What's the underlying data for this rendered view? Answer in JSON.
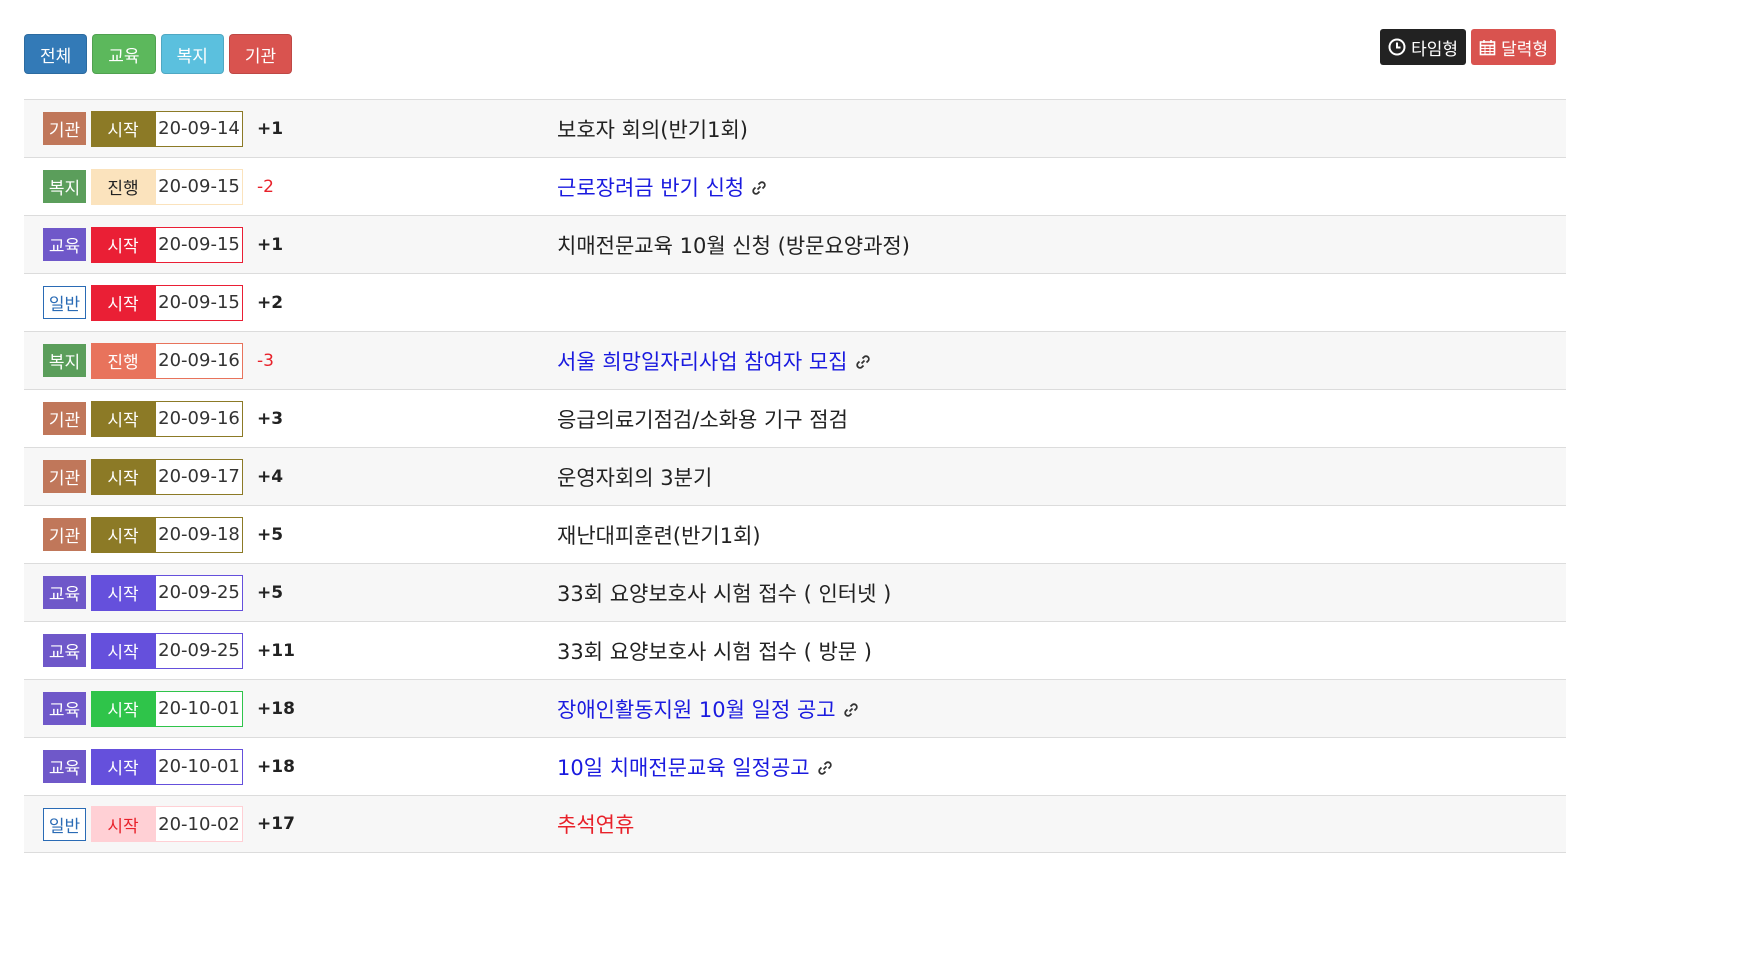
{
  "filters": [
    {
      "label": "전체",
      "color": "#337ab7"
    },
    {
      "label": "교육",
      "color": "#5cb85c"
    },
    {
      "label": "복지",
      "color": "#5bc0de"
    },
    {
      "label": "기관",
      "color": "#d9534f"
    }
  ],
  "view_toggle": {
    "time_label": "타임형",
    "time_icon": "clock-icon",
    "time_color": "#222222",
    "calendar_label": "달력형",
    "calendar_icon": "calendar-icon",
    "calendar_color": "#d9534f"
  },
  "colors": {
    "cat_기관": "#c0775a",
    "cat_복지": "#5b9e5b",
    "cat_교육": "#6f58c9",
    "link": "#1a1adf",
    "holiday": "#e8212a",
    "positive": "#222222",
    "negative": "#e8212a"
  },
  "rows": [
    {
      "category": "기관",
      "status": "시작",
      "date": "20-09-14",
      "diff": "+1",
      "title": "보호자 회의(반기1회)",
      "link": false
    },
    {
      "category": "복지",
      "status": "진행",
      "date": "20-09-15",
      "diff": "-2",
      "title": "근로장려금 반기 신청",
      "link": true
    },
    {
      "category": "교육",
      "status": "시작",
      "date": "20-09-15",
      "diff": "+1",
      "title": "치매전문교육 10월 신청 (방문요양과정)",
      "link": false
    },
    {
      "category": "일반",
      "status": "시작",
      "date": "20-09-15",
      "diff": "+2",
      "title": "",
      "link": false
    },
    {
      "category": "복지",
      "status": "진행",
      "date": "20-09-16",
      "diff": "-3",
      "title": "서울 희망일자리사업 참여자 모집",
      "link": true
    },
    {
      "category": "기관",
      "status": "시작",
      "date": "20-09-16",
      "diff": "+3",
      "title": "응급의료기점검/소화용 기구 점검",
      "link": false
    },
    {
      "category": "기관",
      "status": "시작",
      "date": "20-09-17",
      "diff": "+4",
      "title": "운영자회의 3분기",
      "link": false
    },
    {
      "category": "기관",
      "status": "시작",
      "date": "20-09-18",
      "diff": "+5",
      "title": "재난대피훈련(반기1회)",
      "link": false
    },
    {
      "category": "교육",
      "status": "시작",
      "date": "20-09-25",
      "diff": "+5",
      "title": "33회 요양보호사 시험 접수 ( 인터넷 )",
      "link": false
    },
    {
      "category": "교육",
      "status": "시작",
      "date": "20-09-25",
      "diff": "+11",
      "title": "33회 요양보호사 시험 접수 ( 방문 )",
      "link": false
    },
    {
      "category": "교육",
      "status": "시작",
      "date": "20-10-01",
      "diff": "+18",
      "title": "장애인활동지원 10월 일정 공고",
      "link": true
    },
    {
      "category": "교육",
      "status": "시작",
      "date": "20-10-01",
      "diff": "+18",
      "title": "10일 치매전문교육 일정공고",
      "link": true
    },
    {
      "category": "일반",
      "status": "시작",
      "date": "20-10-02",
      "diff": "+17",
      "title": "추석연휴",
      "link": false,
      "holiday": true
    }
  ]
}
